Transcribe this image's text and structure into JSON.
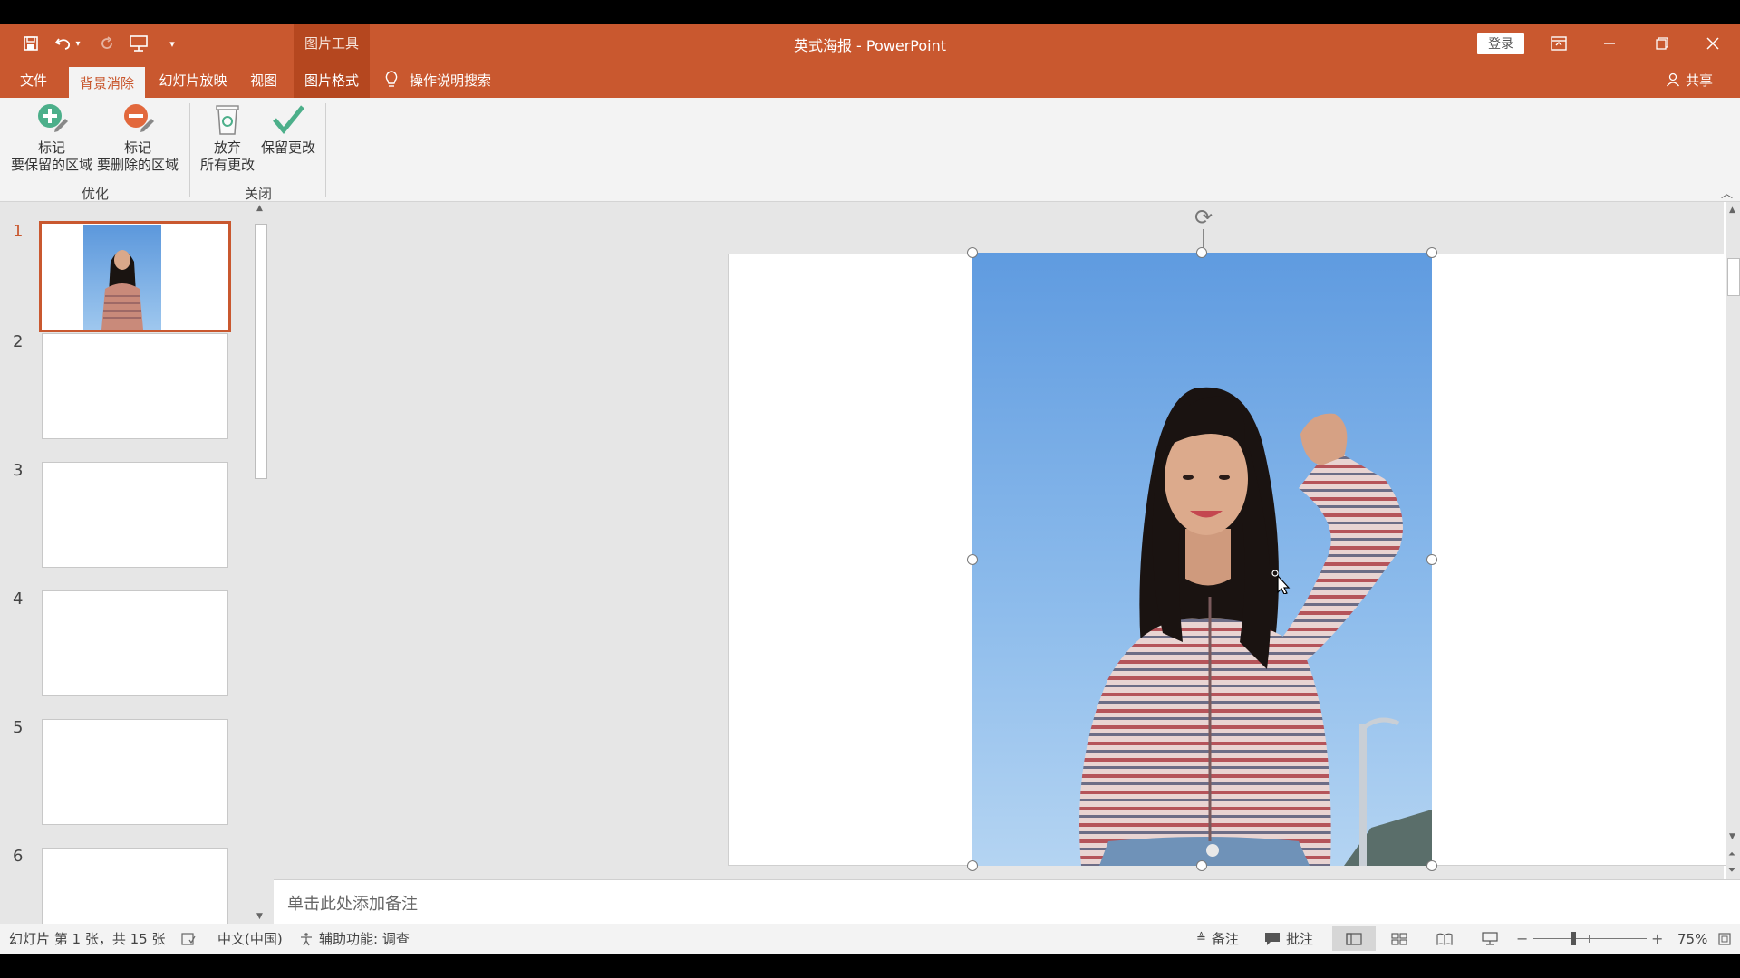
{
  "app": {
    "window_title": "英式海报  -  PowerPoint",
    "context_tools_label": "图片工具",
    "login_label": "登录"
  },
  "tabs": [
    {
      "label": "文件"
    },
    {
      "label": "背景消除"
    },
    {
      "label": "幻灯片放映"
    },
    {
      "label": "视图"
    },
    {
      "label": "图片格式"
    }
  ],
  "tellme_label": "操作说明搜索",
  "share_label": "共享",
  "ribbon": {
    "mark_keep": [
      "标记",
      "要保留的区域"
    ],
    "mark_remove": [
      "标记",
      "要删除的区域"
    ],
    "discard": [
      "放弃",
      "所有更改"
    ],
    "keep_changes": "保留更改",
    "group_refine": "优化",
    "group_close": "关闭"
  },
  "slides": [
    {
      "number": "1"
    },
    {
      "number": "2"
    },
    {
      "number": "3"
    },
    {
      "number": "4"
    },
    {
      "number": "5"
    },
    {
      "number": "6"
    }
  ],
  "notes_placeholder": "单击此处添加备注",
  "status": {
    "slide_info": "幻灯片 第 1 张，共 15 张",
    "language": "中文(中国)",
    "accessibility": "辅助功能: 调查",
    "notes_label": "备注",
    "comments_label": "批注",
    "zoom": "75%"
  },
  "colors": {
    "accent": "#c9582f",
    "ribbon_bg": "#f3f3f3",
    "pane_bg": "#e6e6e6"
  }
}
